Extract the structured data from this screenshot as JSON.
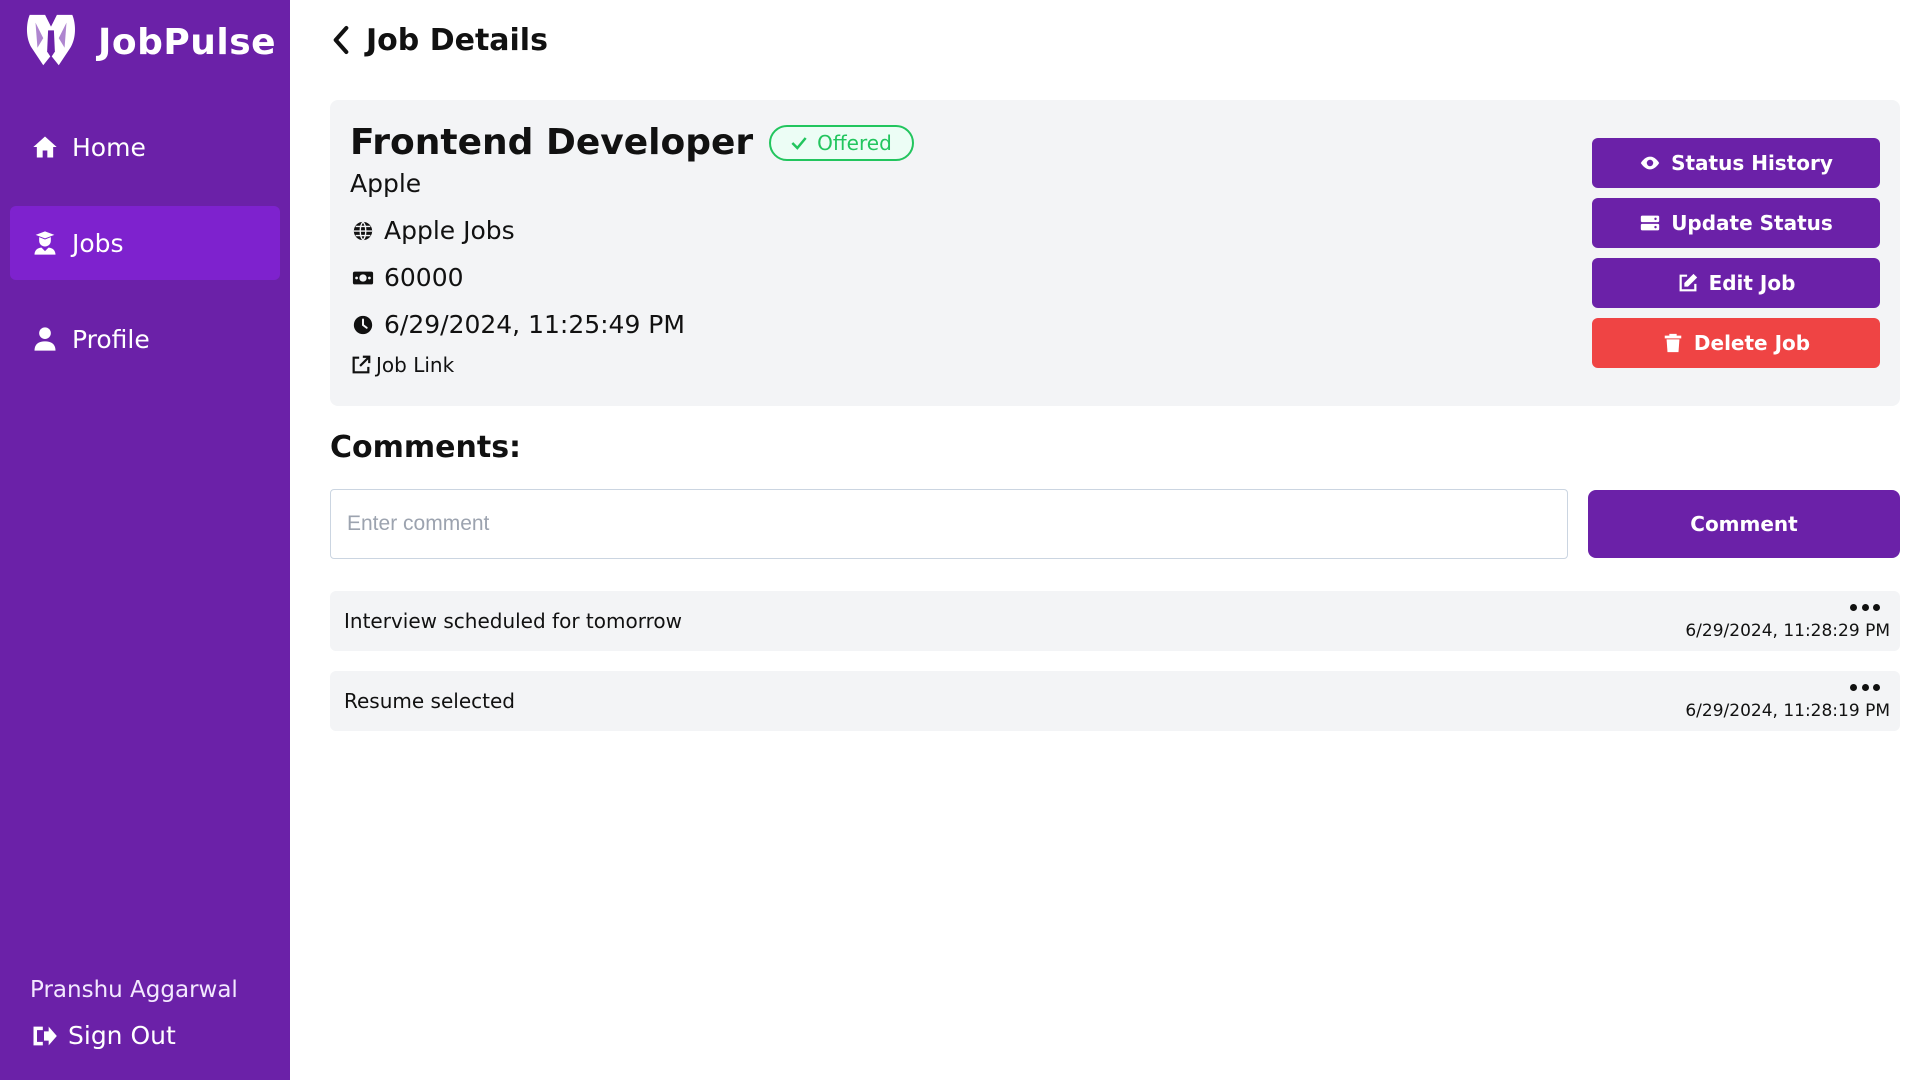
{
  "brand": {
    "name": "JobPulse",
    "logo_icon": "tuxedo-logo"
  },
  "sidebar": {
    "items": [
      {
        "label": "Home",
        "icon": "home-icon",
        "active": false
      },
      {
        "label": "Jobs",
        "icon": "jobs-icon",
        "active": true
      },
      {
        "label": "Profile",
        "icon": "user-icon",
        "active": false
      }
    ],
    "user_name": "Pranshu Aggarwal",
    "signout_label": "Sign Out"
  },
  "header": {
    "title": "Job Details"
  },
  "job": {
    "title": "Frontend Developer",
    "status": "Offered",
    "company": "Apple",
    "source": "Apple Jobs",
    "salary": "60000",
    "date": "6/29/2024, 11:25:49 PM",
    "link_label": "Job Link"
  },
  "actions": {
    "status_history": "Status History",
    "update_status": "Update Status",
    "edit_job": "Edit Job",
    "delete_job": "Delete Job"
  },
  "comments": {
    "title": "Comments:",
    "placeholder": "Enter comment",
    "submit_label": "Comment",
    "items": [
      {
        "text": "Interview scheduled for tomorrow",
        "time": "6/29/2024, 11:28:29 PM"
      },
      {
        "text": "Resume selected",
        "time": "6/29/2024, 11:28:19 PM"
      }
    ]
  },
  "colors": {
    "sidebar": "#6b21a8",
    "sidebar_active": "#7e22ce",
    "primary_button": "#6b21a8",
    "danger_button": "#ef4444",
    "status_offered": "#22c55e",
    "card_background": "#f3f4f6"
  }
}
